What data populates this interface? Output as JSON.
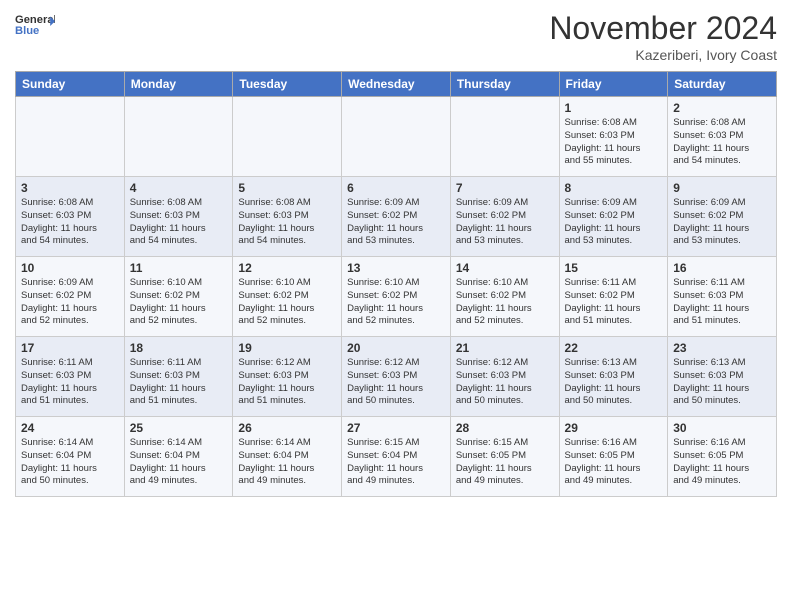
{
  "header": {
    "logo_general": "General",
    "logo_blue": "Blue",
    "month": "November 2024",
    "location": "Kazeriberi, Ivory Coast"
  },
  "weekdays": [
    "Sunday",
    "Monday",
    "Tuesday",
    "Wednesday",
    "Thursday",
    "Friday",
    "Saturday"
  ],
  "weeks": [
    [
      {
        "day": "",
        "info": ""
      },
      {
        "day": "",
        "info": ""
      },
      {
        "day": "",
        "info": ""
      },
      {
        "day": "",
        "info": ""
      },
      {
        "day": "",
        "info": ""
      },
      {
        "day": "1",
        "info": "Sunrise: 6:08 AM\nSunset: 6:03 PM\nDaylight: 11 hours\nand 55 minutes."
      },
      {
        "day": "2",
        "info": "Sunrise: 6:08 AM\nSunset: 6:03 PM\nDaylight: 11 hours\nand 54 minutes."
      }
    ],
    [
      {
        "day": "3",
        "info": "Sunrise: 6:08 AM\nSunset: 6:03 PM\nDaylight: 11 hours\nand 54 minutes."
      },
      {
        "day": "4",
        "info": "Sunrise: 6:08 AM\nSunset: 6:03 PM\nDaylight: 11 hours\nand 54 minutes."
      },
      {
        "day": "5",
        "info": "Sunrise: 6:08 AM\nSunset: 6:03 PM\nDaylight: 11 hours\nand 54 minutes."
      },
      {
        "day": "6",
        "info": "Sunrise: 6:09 AM\nSunset: 6:02 PM\nDaylight: 11 hours\nand 53 minutes."
      },
      {
        "day": "7",
        "info": "Sunrise: 6:09 AM\nSunset: 6:02 PM\nDaylight: 11 hours\nand 53 minutes."
      },
      {
        "day": "8",
        "info": "Sunrise: 6:09 AM\nSunset: 6:02 PM\nDaylight: 11 hours\nand 53 minutes."
      },
      {
        "day": "9",
        "info": "Sunrise: 6:09 AM\nSunset: 6:02 PM\nDaylight: 11 hours\nand 53 minutes."
      }
    ],
    [
      {
        "day": "10",
        "info": "Sunrise: 6:09 AM\nSunset: 6:02 PM\nDaylight: 11 hours\nand 52 minutes."
      },
      {
        "day": "11",
        "info": "Sunrise: 6:10 AM\nSunset: 6:02 PM\nDaylight: 11 hours\nand 52 minutes."
      },
      {
        "day": "12",
        "info": "Sunrise: 6:10 AM\nSunset: 6:02 PM\nDaylight: 11 hours\nand 52 minutes."
      },
      {
        "day": "13",
        "info": "Sunrise: 6:10 AM\nSunset: 6:02 PM\nDaylight: 11 hours\nand 52 minutes."
      },
      {
        "day": "14",
        "info": "Sunrise: 6:10 AM\nSunset: 6:02 PM\nDaylight: 11 hours\nand 52 minutes."
      },
      {
        "day": "15",
        "info": "Sunrise: 6:11 AM\nSunset: 6:02 PM\nDaylight: 11 hours\nand 51 minutes."
      },
      {
        "day": "16",
        "info": "Sunrise: 6:11 AM\nSunset: 6:03 PM\nDaylight: 11 hours\nand 51 minutes."
      }
    ],
    [
      {
        "day": "17",
        "info": "Sunrise: 6:11 AM\nSunset: 6:03 PM\nDaylight: 11 hours\nand 51 minutes."
      },
      {
        "day": "18",
        "info": "Sunrise: 6:11 AM\nSunset: 6:03 PM\nDaylight: 11 hours\nand 51 minutes."
      },
      {
        "day": "19",
        "info": "Sunrise: 6:12 AM\nSunset: 6:03 PM\nDaylight: 11 hours\nand 51 minutes."
      },
      {
        "day": "20",
        "info": "Sunrise: 6:12 AM\nSunset: 6:03 PM\nDaylight: 11 hours\nand 50 minutes."
      },
      {
        "day": "21",
        "info": "Sunrise: 6:12 AM\nSunset: 6:03 PM\nDaylight: 11 hours\nand 50 minutes."
      },
      {
        "day": "22",
        "info": "Sunrise: 6:13 AM\nSunset: 6:03 PM\nDaylight: 11 hours\nand 50 minutes."
      },
      {
        "day": "23",
        "info": "Sunrise: 6:13 AM\nSunset: 6:03 PM\nDaylight: 11 hours\nand 50 minutes."
      }
    ],
    [
      {
        "day": "24",
        "info": "Sunrise: 6:14 AM\nSunset: 6:04 PM\nDaylight: 11 hours\nand 50 minutes."
      },
      {
        "day": "25",
        "info": "Sunrise: 6:14 AM\nSunset: 6:04 PM\nDaylight: 11 hours\nand 49 minutes."
      },
      {
        "day": "26",
        "info": "Sunrise: 6:14 AM\nSunset: 6:04 PM\nDaylight: 11 hours\nand 49 minutes."
      },
      {
        "day": "27",
        "info": "Sunrise: 6:15 AM\nSunset: 6:04 PM\nDaylight: 11 hours\nand 49 minutes."
      },
      {
        "day": "28",
        "info": "Sunrise: 6:15 AM\nSunset: 6:05 PM\nDaylight: 11 hours\nand 49 minutes."
      },
      {
        "day": "29",
        "info": "Sunrise: 6:16 AM\nSunset: 6:05 PM\nDaylight: 11 hours\nand 49 minutes."
      },
      {
        "day": "30",
        "info": "Sunrise: 6:16 AM\nSunset: 6:05 PM\nDaylight: 11 hours\nand 49 minutes."
      }
    ]
  ]
}
